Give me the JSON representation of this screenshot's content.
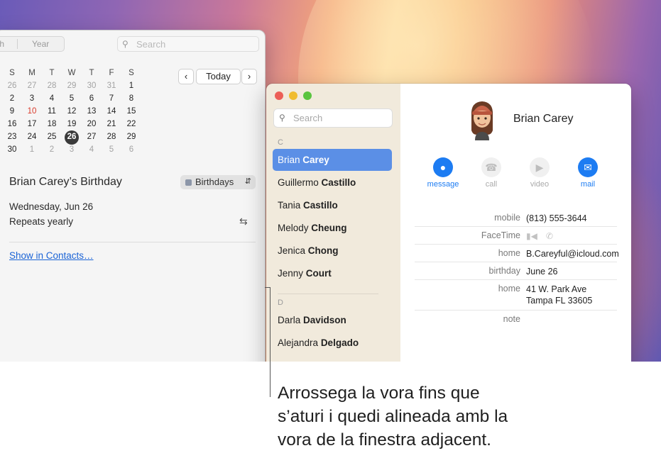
{
  "calendar": {
    "toolbar": {
      "month_tab_partial": "th",
      "year_tab": "Year",
      "search_placeholder": "Search"
    },
    "mini_calendar": {
      "weekdays": [
        "S",
        "M",
        "T",
        "W",
        "T",
        "F",
        "S"
      ],
      "weeks": [
        [
          "26",
          "27",
          "28",
          "29",
          "30",
          "31",
          "1"
        ],
        [
          "2",
          "3",
          "4",
          "5",
          "6",
          "7",
          "8"
        ],
        [
          "9",
          "10",
          "11",
          "12",
          "13",
          "14",
          "15"
        ],
        [
          "16",
          "17",
          "18",
          "19",
          "20",
          "21",
          "22"
        ],
        [
          "23",
          "24",
          "25",
          "26",
          "27",
          "28",
          "29"
        ],
        [
          "30",
          "1",
          "2",
          "3",
          "4",
          "5",
          "6"
        ]
      ],
      "today_button": "Today",
      "prev_icon": "chevron-left-icon",
      "next_icon": "chevron-right-icon",
      "selected_day": "26",
      "today_day": "10"
    },
    "event": {
      "title": "Brian Carey’s Birthday",
      "calendar_name": "Birthdays",
      "date": "Wednesday, Jun 26",
      "repeat": "Repeats yearly",
      "show_in_contacts": "Show in Contacts…"
    }
  },
  "contacts": {
    "search_placeholder": "Search",
    "sections": [
      {
        "letter": "C",
        "items": [
          {
            "first": "Brian",
            "last": "Carey",
            "selected": true
          },
          {
            "first": "Guillermo",
            "last": "Castillo"
          },
          {
            "first": "Tania",
            "last": "Castillo"
          },
          {
            "first": "Melody",
            "last": "Cheung"
          },
          {
            "first": "Jenica",
            "last": "Chong"
          },
          {
            "first": "Jenny",
            "last": "Court"
          }
        ]
      },
      {
        "letter": "D",
        "items": [
          {
            "first": "Darla",
            "last": "Davidson"
          },
          {
            "first": "Alejandra",
            "last": "Delgado"
          }
        ]
      }
    ],
    "detail": {
      "name": "Brian Carey",
      "actions": [
        {
          "label": "message",
          "icon": "message-bubble-icon",
          "enabled": true
        },
        {
          "label": "call",
          "icon": "phone-icon",
          "enabled": false
        },
        {
          "label": "video",
          "icon": "video-camera-icon",
          "enabled": false
        },
        {
          "label": "mail",
          "icon": "envelope-icon",
          "enabled": true
        }
      ],
      "fields": {
        "mobile_label": "mobile",
        "mobile_value": "(813) 555-3644",
        "facetime_label": "FaceTime",
        "email_label": "home",
        "email_value": "B.Careyful@icloud.com",
        "birthday_label": "birthday",
        "birthday_value": "June 26",
        "address_label": "home",
        "address_line1": "41 W. Park Ave",
        "address_line2": "Tampa FL 33605",
        "note_label": "note"
      }
    }
  },
  "callout": {
    "lines": [
      "Arrossega la vora fins que",
      "s’aturi i quedi alineada amb la",
      "vora de la finestra adjacent."
    ]
  },
  "colors": {
    "accent": "#1d7cf2",
    "selection": "#5b8fe6",
    "today_red": "#d93a2b"
  }
}
